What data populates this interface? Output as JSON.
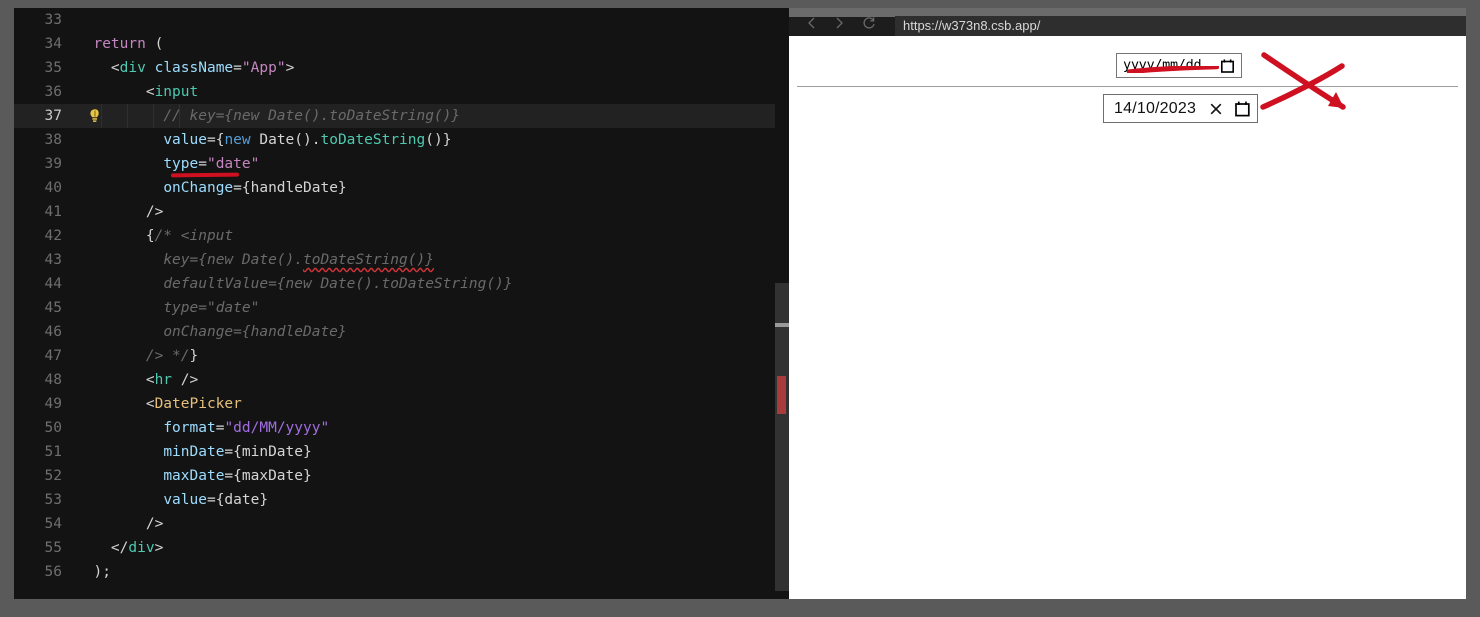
{
  "editor": {
    "language": "jsx",
    "active_line": 37,
    "quick_fix_icon": "lightbulb-icon",
    "lines": [
      {
        "num": "33",
        "tokens": []
      },
      {
        "num": "34",
        "tokens": [
          {
            "t": "  ",
            "c": "t-plain"
          },
          {
            "t": "return",
            "c": "t-kw"
          },
          {
            "t": " (",
            "c": "t-plain"
          }
        ]
      },
      {
        "num": "35",
        "tokens": [
          {
            "t": "    <",
            "c": "t-plain"
          },
          {
            "t": "div",
            "c": "t-tag"
          },
          {
            "t": " ",
            "c": "t-plain"
          },
          {
            "t": "className",
            "c": "t-attr"
          },
          {
            "t": "=",
            "c": "t-plain"
          },
          {
            "t": "\"App\"",
            "c": "t-str"
          },
          {
            "t": ">",
            "c": "t-plain"
          }
        ]
      },
      {
        "num": "36",
        "tokens": [
          {
            "t": "        <",
            "c": "t-plain"
          },
          {
            "t": "input",
            "c": "t-tag"
          }
        ]
      },
      {
        "num": "37",
        "tokens": [
          {
            "t": "          ",
            "c": "t-plain"
          },
          {
            "t": "// key={new Date().toDateString()}",
            "c": "t-comment"
          }
        ]
      },
      {
        "num": "38",
        "tokens": [
          {
            "t": "          ",
            "c": "t-plain"
          },
          {
            "t": "value",
            "c": "t-attr"
          },
          {
            "t": "={",
            "c": "t-plain"
          },
          {
            "t": "new",
            "c": "t-new"
          },
          {
            "t": " Date().",
            "c": "t-plain"
          },
          {
            "t": "toDateString",
            "c": "t-fn"
          },
          {
            "t": "()}",
            "c": "t-plain"
          }
        ]
      },
      {
        "num": "39",
        "tokens": [
          {
            "t": "          ",
            "c": "t-plain"
          },
          {
            "t": "type",
            "c": "t-attr"
          },
          {
            "t": "=",
            "c": "t-plain"
          },
          {
            "t": "\"date\"",
            "c": "t-str"
          }
        ]
      },
      {
        "num": "40",
        "tokens": [
          {
            "t": "          ",
            "c": "t-plain"
          },
          {
            "t": "onChange",
            "c": "t-attr"
          },
          {
            "t": "=",
            "c": "t-plain"
          },
          {
            "t": "{handleDate}",
            "c": "t-plain"
          }
        ]
      },
      {
        "num": "41",
        "tokens": [
          {
            "t": "        />",
            "c": "t-plain"
          }
        ]
      },
      {
        "num": "42",
        "tokens": [
          {
            "t": "        {",
            "c": "t-comment-b"
          },
          {
            "t": "/* <input",
            "c": "t-comment"
          }
        ]
      },
      {
        "num": "43",
        "tokens": [
          {
            "t": "          ",
            "c": "t-plain"
          },
          {
            "t": "key={new Date().",
            "c": "t-comment"
          },
          {
            "t": "toDateString()}",
            "c": "t-comment squiggle"
          }
        ]
      },
      {
        "num": "44",
        "tokens": [
          {
            "t": "          ",
            "c": "t-plain"
          },
          {
            "t": "defaultValue={new Date().toDateString()}",
            "c": "t-comment"
          }
        ]
      },
      {
        "num": "45",
        "tokens": [
          {
            "t": "          ",
            "c": "t-plain"
          },
          {
            "t": "type=\"date\"",
            "c": "t-comment"
          }
        ]
      },
      {
        "num": "46",
        "tokens": [
          {
            "t": "          ",
            "c": "t-plain"
          },
          {
            "t": "onChange={handleDate}",
            "c": "t-comment"
          }
        ]
      },
      {
        "num": "47",
        "tokens": [
          {
            "t": "        ",
            "c": "t-plain"
          },
          {
            "t": "/> */",
            "c": "t-comment"
          },
          {
            "t": "}",
            "c": "t-comment-b"
          }
        ]
      },
      {
        "num": "48",
        "tokens": [
          {
            "t": "        <",
            "c": "t-plain"
          },
          {
            "t": "hr",
            "c": "t-tag"
          },
          {
            "t": " />",
            "c": "t-plain"
          }
        ]
      },
      {
        "num": "49",
        "tokens": [
          {
            "t": "        <",
            "c": "t-plain"
          },
          {
            "t": "DatePicker",
            "c": "t-comp"
          }
        ]
      },
      {
        "num": "50",
        "tokens": [
          {
            "t": "          ",
            "c": "t-plain"
          },
          {
            "t": "format",
            "c": "t-attr"
          },
          {
            "t": "=",
            "c": "t-plain"
          },
          {
            "t": "\"dd/MM/yyyy\"",
            "c": "t-str2"
          }
        ]
      },
      {
        "num": "51",
        "tokens": [
          {
            "t": "          ",
            "c": "t-plain"
          },
          {
            "t": "minDate",
            "c": "t-attr"
          },
          {
            "t": "={minDate}",
            "c": "t-plain"
          }
        ]
      },
      {
        "num": "52",
        "tokens": [
          {
            "t": "          ",
            "c": "t-plain"
          },
          {
            "t": "maxDate",
            "c": "t-attr"
          },
          {
            "t": "={maxDate}",
            "c": "t-plain"
          }
        ]
      },
      {
        "num": "53",
        "tokens": [
          {
            "t": "          ",
            "c": "t-plain"
          },
          {
            "t": "value",
            "c": "t-attr"
          },
          {
            "t": "={date}",
            "c": "t-plain"
          }
        ]
      },
      {
        "num": "54",
        "tokens": [
          {
            "t": "        />",
            "c": "t-plain"
          }
        ]
      },
      {
        "num": "55",
        "tokens": [
          {
            "t": "    </",
            "c": "t-plain"
          },
          {
            "t": "div",
            "c": "t-tag"
          },
          {
            "t": ">",
            "c": "t-plain"
          }
        ]
      },
      {
        "num": "56",
        "tokens": [
          {
            "t": "  );",
            "c": "t-plain"
          }
        ]
      }
    ]
  },
  "browser": {
    "back_icon": "chevron-left-icon",
    "forward_icon": "chevron-right-icon",
    "reload_icon": "reload-icon",
    "url": "https://w373n8.csb.app/"
  },
  "page": {
    "native_date_input": {
      "placeholder_year": "yyyy",
      "placeholder_month": "mm",
      "placeholder_day": "dd",
      "separator": "/",
      "calendar_icon": "calendar-icon"
    },
    "custom_date_picker": {
      "value": "14/10/2023",
      "clear_icon": "close-icon",
      "calendar_icon": "calendar-icon"
    }
  },
  "annotations": {
    "code_underline_target": "value=",
    "browser_underline_target": "native-date-input",
    "cross_out_target": "native-date-input",
    "color": "#cf1020"
  }
}
